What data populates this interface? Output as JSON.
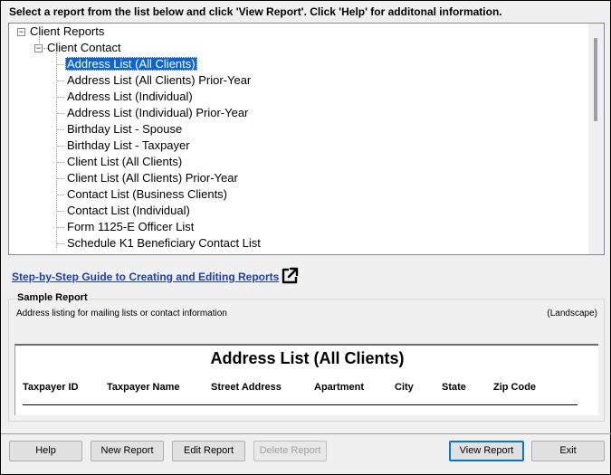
{
  "instruction": "Select a report from the list below and click 'View Report'. Click 'Help' for additonal information.",
  "tree": {
    "root": "Client Reports",
    "group": "Client Contact",
    "items": [
      {
        "label": "Address List (All Clients)",
        "selected": true
      },
      {
        "label": "Address List (All Clients) Prior-Year"
      },
      {
        "label": "Address List (Individual)"
      },
      {
        "label": "Address List (Individual) Prior-Year"
      },
      {
        "label": "Birthday List - Spouse"
      },
      {
        "label": "Birthday List - Taxpayer"
      },
      {
        "label": "Client List (All Clients)"
      },
      {
        "label": "Client List (All Clients) Prior-Year"
      },
      {
        "label": "Contact List (Business Clients)"
      },
      {
        "label": "Contact List (Individual)"
      },
      {
        "label": "Form 1125-E Officer List"
      },
      {
        "label": "Schedule K1 Beneficiary Contact List"
      }
    ]
  },
  "guide_link": "Step-by-Step Guide to Creating and Editing Reports",
  "sample": {
    "title": "Sample Report",
    "description": "Address listing for mailing lists or contact information",
    "orientation": "(Landscape)",
    "preview_title": "Address List (All Clients)",
    "columns": [
      "Taxpayer ID",
      "Taxpayer Name",
      "Street Address",
      "Apartment",
      "City",
      "State",
      "Zip Code"
    ]
  },
  "buttons": {
    "help": "Help",
    "new_report": "New Report",
    "edit_report": "Edit Report",
    "delete_report": "Delete Report",
    "view_report": "View Report",
    "exit": "Exit"
  },
  "colors": {
    "selection": "#0a64d6",
    "link": "#1a3fb4",
    "default_button_border": "#0078d7"
  },
  "icons": [
    "expand-collapse-minus-icon",
    "external-link-icon"
  ]
}
